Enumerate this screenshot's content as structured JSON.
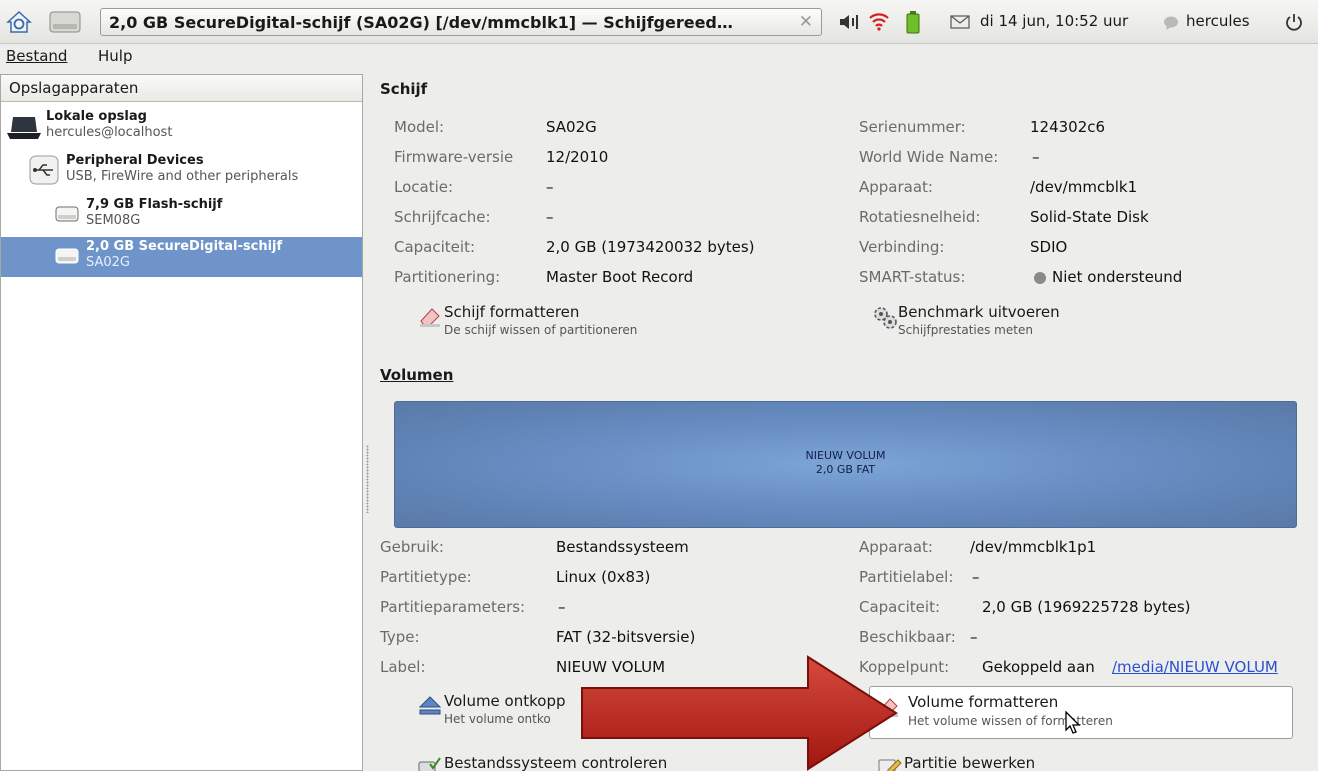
{
  "panel": {
    "window_title": "2,0 GB SecureDigital-schijf (SA02G) [/dev/mmcblk1] — Schijfgereed…",
    "datetime": "di 14 jun, 10:52 uur",
    "user": "hercules"
  },
  "menubar": {
    "file": "Bestand",
    "help": "Hulp"
  },
  "sidebar": {
    "header": "Opslagapparaten",
    "items": [
      {
        "title": "Lokale opslag",
        "sub": "hercules@localhost"
      },
      {
        "title": "Peripheral Devices",
        "sub": "USB, FireWire and other peripherals"
      },
      {
        "title": "7,9 GB Flash-schijf",
        "sub": "SEM08G"
      },
      {
        "title": "2,0 GB SecureDigital-schijf",
        "sub": "SA02G"
      }
    ]
  },
  "disk": {
    "title": "Schijf",
    "left": [
      {
        "label": "Model:",
        "value": "SA02G"
      },
      {
        "label": "Firmware-versie",
        "value": "12/2010"
      },
      {
        "label": "Locatie:",
        "value": "–"
      },
      {
        "label": "Schrijfcache:",
        "value": "–"
      },
      {
        "label": "Capaciteit:",
        "value": "2,0 GB (1973420032 bytes)"
      },
      {
        "label": "Partitionering:",
        "value": "Master Boot Record"
      }
    ],
    "right": [
      {
        "label": "Serienummer:",
        "value": "124302c6"
      },
      {
        "label": "World Wide Name:",
        "value": "–"
      },
      {
        "label": "Apparaat:",
        "value": "/dev/mmcblk1"
      },
      {
        "label": "Rotatiesnelheid:",
        "value": "Solid-State Disk"
      },
      {
        "label": "Verbinding:",
        "value": "SDIO"
      },
      {
        "label": "SMART-status:",
        "value": "Niet ondersteund"
      }
    ],
    "format_title": "Schijf formatteren",
    "format_sub": "De schijf wissen of partitioneren",
    "bench_title": "Benchmark uitvoeren",
    "bench_sub": "Schijfprestaties meten"
  },
  "volume": {
    "title": "Volumen",
    "map_name": "NIEUW VOLUM",
    "map_sub": "2,0 GB FAT",
    "left": [
      {
        "label": "Gebruik:",
        "value": "Bestandssysteem"
      },
      {
        "label": "Partitietype:",
        "value": "Linux (0x83)"
      },
      {
        "label": "Partitieparameters:",
        "value": "–"
      },
      {
        "label": "Type:",
        "value": "FAT (32-bitsversie)"
      },
      {
        "label": "Label:",
        "value": "NIEUW VOLUM"
      }
    ],
    "right": [
      {
        "label": "Apparaat:",
        "value": "/dev/mmcblk1p1"
      },
      {
        "label": "Partitielabel:",
        "value": "–"
      },
      {
        "label": "Capaciteit:",
        "value": "2,0 GB (1969225728 bytes)"
      },
      {
        "label": "Beschikbaar:",
        "value": "–"
      },
      {
        "label": "Koppelpunt:",
        "value_prefix": "Gekoppeld aan",
        "value_link": "/media/NIEUW VOLUM"
      }
    ],
    "unmount_title": "Volume ontkopp",
    "unmount_sub": "Het volume ontko",
    "format_title": "Volume formatteren",
    "format_sub": "Het volume wissen of formatteren",
    "check_title": "Bestandssysteem controleren",
    "edit_title": "Partitie bewerken"
  },
  "colors": {
    "selection": "#6f94c9",
    "arrow": "#b41f1a",
    "link": "#2b4fd1"
  }
}
